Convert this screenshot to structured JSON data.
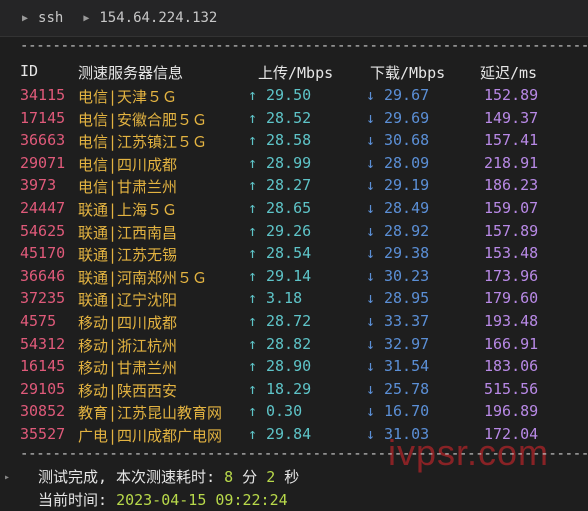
{
  "titlebar": {
    "shell": "ssh",
    "host": "154.64.224.132"
  },
  "divider": "--------------------------------------------------------------------------------",
  "header": {
    "id": "ID",
    "node": "测速服务器信息",
    "up": "上传/Mbps",
    "down": "下载/Mbps",
    "latency": "延迟/ms"
  },
  "arrows": {
    "up": "↑",
    "down": "↓"
  },
  "rows": [
    {
      "id": "34115",
      "node": "电信|天津５Ｇ",
      "up": "29.50",
      "down": "29.67",
      "latency": "152.89"
    },
    {
      "id": "17145",
      "node": "电信|安徽合肥５Ｇ",
      "up": "28.52",
      "down": "29.69",
      "latency": "149.37"
    },
    {
      "id": "36663",
      "node": "电信|江苏镇江５Ｇ",
      "up": "28.58",
      "down": "30.68",
      "latency": "157.41"
    },
    {
      "id": "29071",
      "node": "电信|四川成都",
      "up": "28.99",
      "down": "28.09",
      "latency": "218.91"
    },
    {
      "id": "3973",
      "node": "电信|甘肃兰州",
      "up": "28.27",
      "down": "29.19",
      "latency": "186.23"
    },
    {
      "id": "24447",
      "node": "联通|上海５Ｇ",
      "up": "28.65",
      "down": "28.49",
      "latency": "159.07"
    },
    {
      "id": "54625",
      "node": "联通|江西南昌",
      "up": "29.26",
      "down": "28.92",
      "latency": "157.89"
    },
    {
      "id": "45170",
      "node": "联通|江苏无锡",
      "up": "28.54",
      "down": "29.38",
      "latency": "153.48"
    },
    {
      "id": "36646",
      "node": "联通|河南郑州５Ｇ",
      "up": "29.14",
      "down": "30.23",
      "latency": "173.96"
    },
    {
      "id": "37235",
      "node": "联通|辽宁沈阳",
      "up": "3.18",
      "down": "28.95",
      "latency": "179.60"
    },
    {
      "id": "4575",
      "node": "移动|四川成都",
      "up": "28.72",
      "down": "33.37",
      "latency": "193.48"
    },
    {
      "id": "54312",
      "node": "移动|浙江杭州",
      "up": "28.82",
      "down": "32.97",
      "latency": "166.91"
    },
    {
      "id": "16145",
      "node": "移动|甘肃兰州",
      "up": "28.90",
      "down": "31.54",
      "latency": "183.06"
    },
    {
      "id": "29105",
      "node": "移动|陕西西安",
      "up": "18.29",
      "down": "25.78",
      "latency": "515.56"
    },
    {
      "id": "30852",
      "node": "教育|江苏昆山教育网",
      "up": "0.30",
      "down": "16.70",
      "latency": "196.89"
    },
    {
      "id": "35527",
      "node": "广电|四川成都广电网",
      "up": "29.84",
      "down": "31.03",
      "latency": "172.04"
    }
  ],
  "footer": {
    "gutter": "▸",
    "done_prefix": "测试完成, 本次测速耗时: ",
    "minutes": "8",
    "min_unit": " 分 ",
    "seconds": "2",
    "sec_unit": " 秒",
    "time_label": "当前时间: ",
    "time_value": "2023-04-15 09:22:24"
  },
  "watermark": "ivpsr.com",
  "colors": {
    "id": "#e05a7a",
    "node": "#e3b341",
    "up": "#5ec4c8",
    "down": "#5b8fd6",
    "latency": "#b889e6",
    "accent": "#b8d94a"
  }
}
